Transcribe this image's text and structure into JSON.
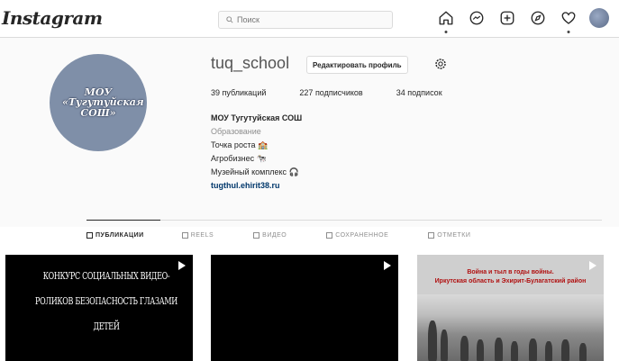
{
  "nav": {
    "logo": "Instagram",
    "search_placeholder": "Поиск",
    "icons": [
      "home-icon",
      "messenger-icon",
      "new-post-icon",
      "explore-icon",
      "heart-icon",
      "profile-avatar"
    ]
  },
  "profile": {
    "avatar_text": "МОУ «Тугутуйская СОШ»",
    "username": "tuq_school",
    "edit_button": "Редактировать профиль",
    "stats": {
      "posts": "39",
      "posts_label": "публикаций",
      "followers": "227",
      "followers_label": "подписчиков",
      "following": "34",
      "following_label": "подписок"
    },
    "bio": {
      "name": "МОУ Тугутуйская СОШ",
      "category": "Образование",
      "line1": "Точка роста 🏫",
      "line2": "Агробизнес 🐄",
      "line3": "Музейный комплекс 🎧",
      "link": "tugthul.ehirit38.ru"
    }
  },
  "tabs": [
    {
      "label": "Публикации",
      "active": true
    },
    {
      "label": "Reels",
      "active": false
    },
    {
      "label": "Видео",
      "active": false
    },
    {
      "label": "Сохраненное",
      "active": false
    },
    {
      "label": "Отметки",
      "active": false
    }
  ],
  "posts": {
    "post1_text": "КОНКУРС СОЦИАЛЬНЫХ ВИДЕО-РОЛИКОВ БЕЗОПАСНОСТЬ ГЛАЗАМИ ДЕТЕЙ",
    "post3_title_1": "Война и тыл в годы войны.",
    "post3_title_2": "Иркутская область и Эхирит-Булагатский район"
  },
  "colors": {
    "background": "#fafafa",
    "border": "#dbdbdb",
    "link": "#00376b",
    "avatar": "#7f8fa8"
  }
}
